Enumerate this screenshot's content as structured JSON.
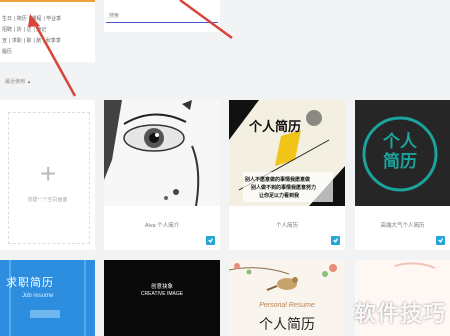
{
  "tags": {
    "row1": [
      "生日",
      "简历",
      "课程",
      "毕业季"
    ],
    "row2": [
      "招聘",
      "折",
      "达",
      "游记"
    ],
    "row3": [
      "宣",
      "求职",
      "职",
      "旅",
      "秋季季"
    ],
    "row4": [
      "履历"
    ]
  },
  "search": {
    "text": "搜索"
  },
  "sort": {
    "label": "最近使用"
  },
  "create_tile": {
    "label": "创建一个空白画面"
  },
  "tiles": {
    "alva": {
      "caption": "Alva 个人简介"
    },
    "person": {
      "caption": "个人简历",
      "cover_title": "个人简历",
      "cover_line1": "别人不愿意做的事情我愿意做",
      "cover_line2": "别人做不到的事情我愿意努力",
      "cover_line3": "让你足以力看到我"
    },
    "teal": {
      "caption": "高端大气个人简历",
      "cover_line1": "个人",
      "cover_line2": "简历"
    },
    "blue": {
      "cover_title": "求职简历",
      "cover_sub": "Job resume"
    },
    "black": {
      "cover_title": "创意抉象",
      "cover_sub": "CREATIVE IMAGE"
    },
    "bird": {
      "cover_en": "Personal Resume",
      "cover_title": "个人简历"
    }
  },
  "watermark": "软件技巧",
  "colors": {
    "accent_orange": "#f2a23b",
    "accent_blue": "#26a6d6",
    "search_line": "#4a55c8",
    "annotation": "#d9453a"
  }
}
